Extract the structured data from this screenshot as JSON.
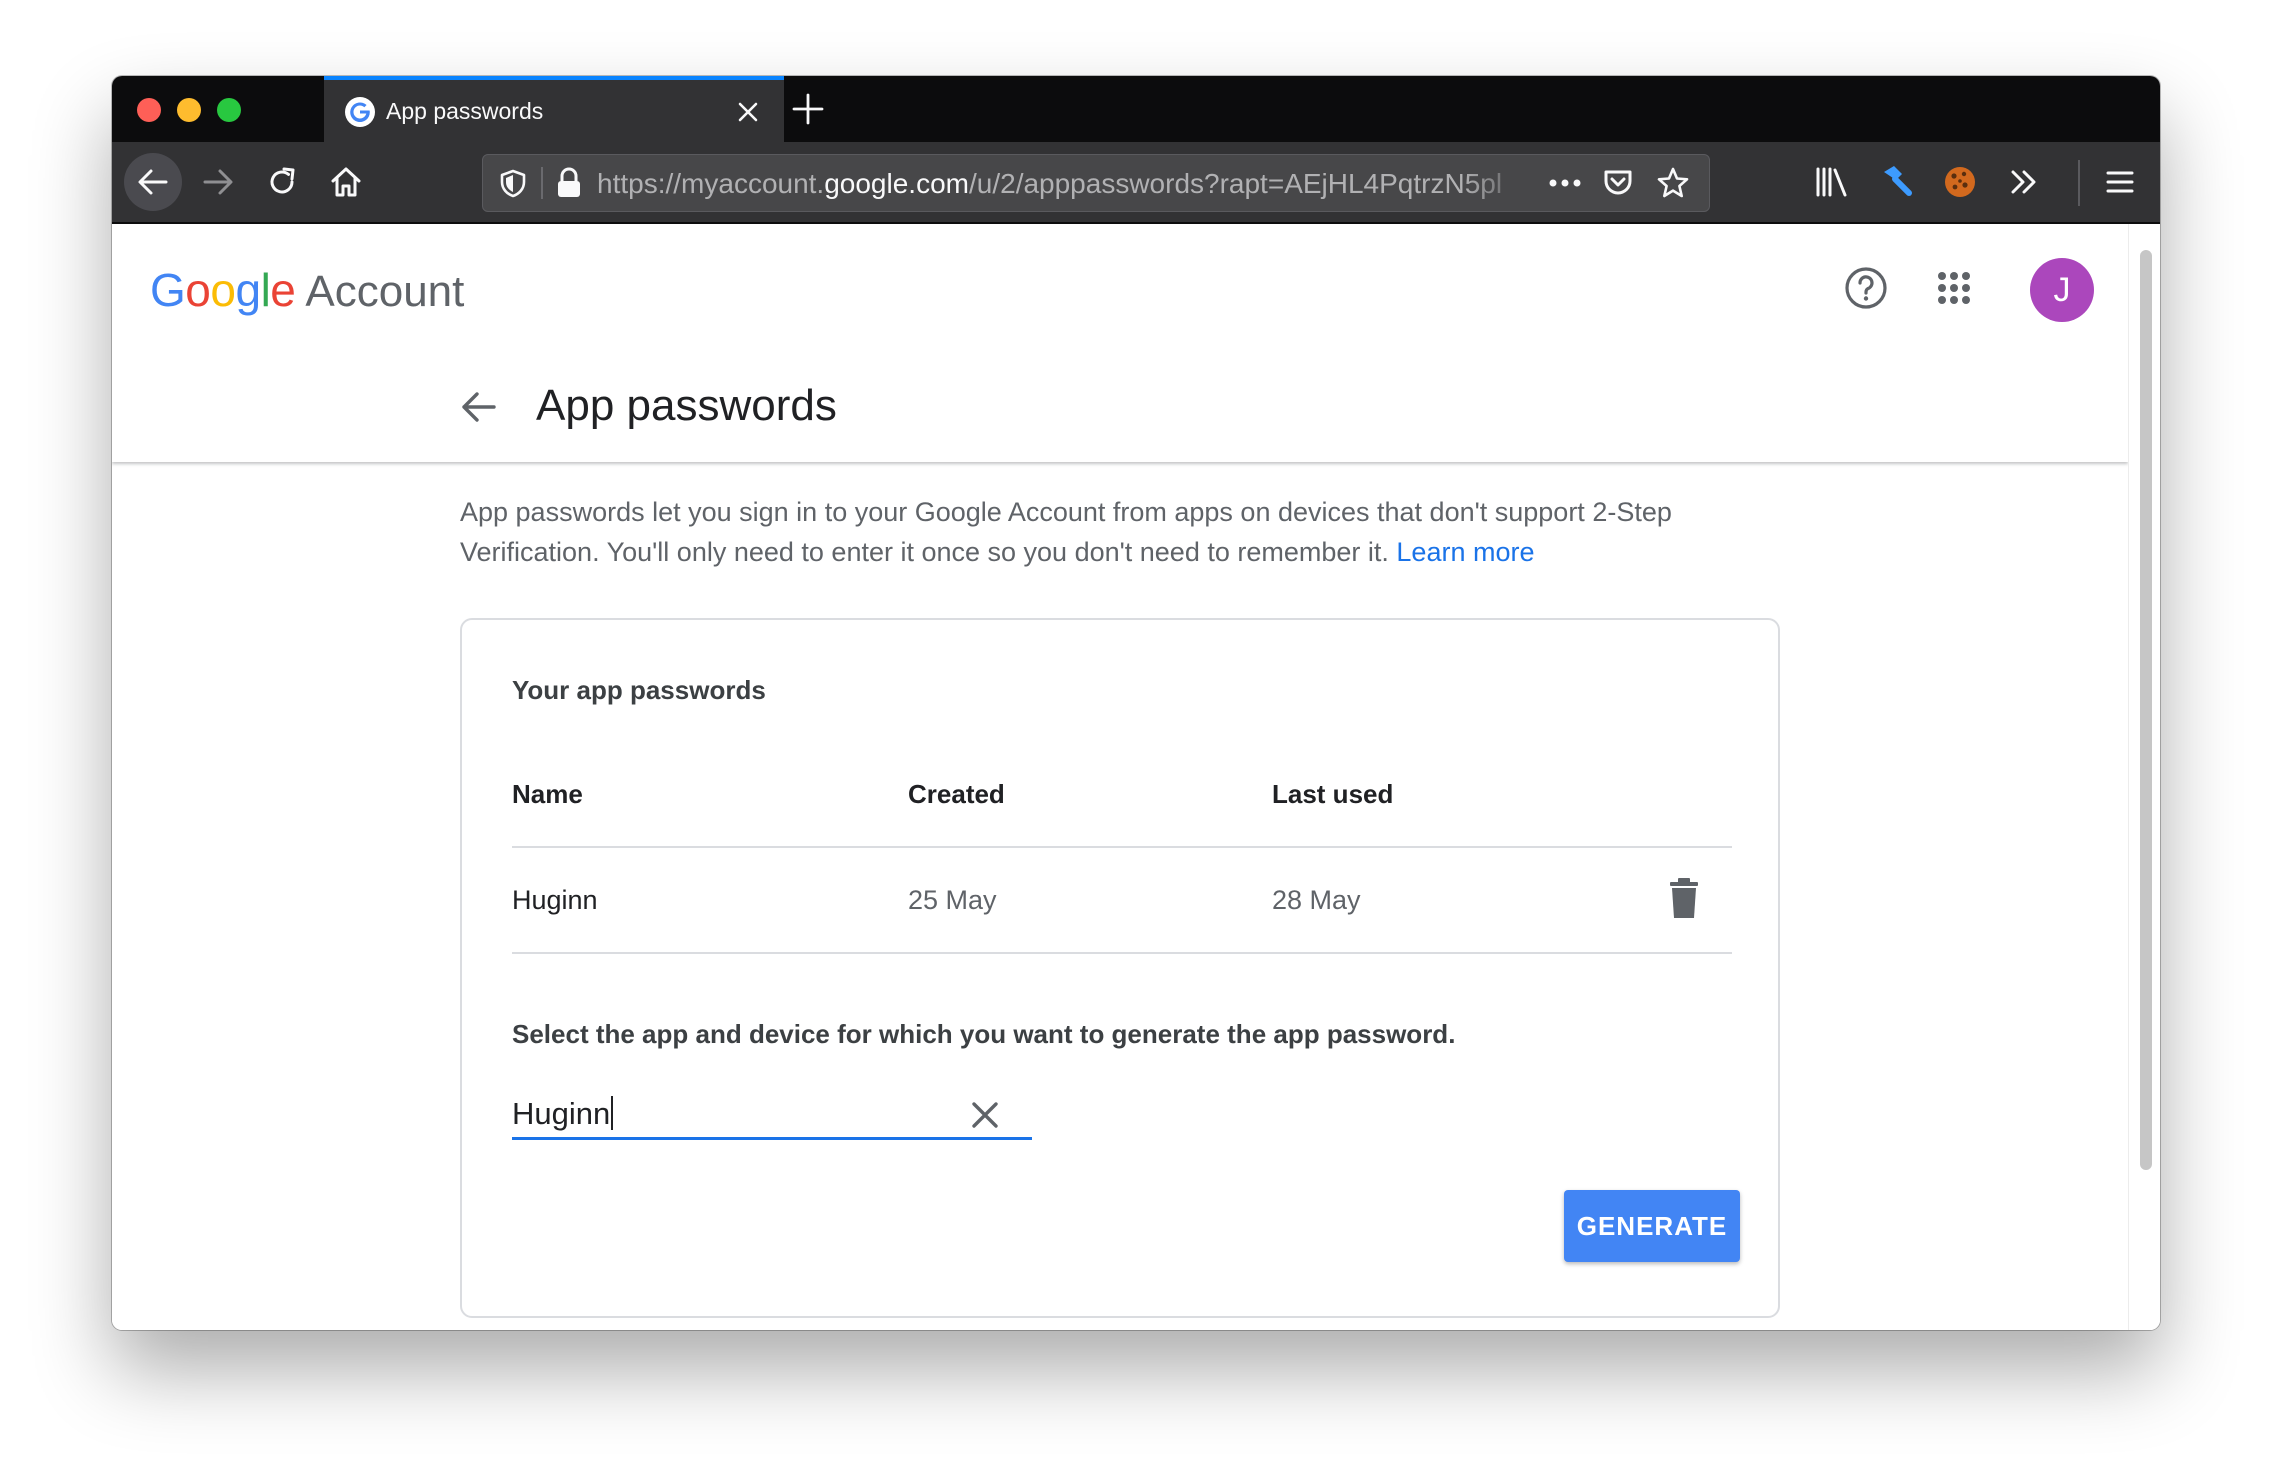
{
  "browser": {
    "tab_title": "App passwords",
    "url_prefix": "https://myaccount.",
    "url_domain": "google.com",
    "url_path": "/u/2/apppasswords?rapt=AEjHL4PqtrzN5pl"
  },
  "header": {
    "logo_letters": [
      "G",
      "o",
      "o",
      "g",
      "l",
      "e"
    ],
    "logo_colors": [
      "#4285f4",
      "#ea4335",
      "#fbbc05",
      "#4285f4",
      "#34a853",
      "#ea4335"
    ],
    "logo_suffix": "Account",
    "avatar_initial": "J",
    "avatar_color": "#ab47bc"
  },
  "page": {
    "title": "App passwords",
    "intro": "App passwords let you sign in to your Google Account from apps on devices that don't support 2-Step Verification. You'll only need to enter it once so you don't need to remember it.",
    "learn_more": "Learn more"
  },
  "card": {
    "title": "Your app passwords",
    "columns": [
      "Name",
      "Created",
      "Last used"
    ],
    "rows": [
      {
        "name": "Huginn",
        "created": "25 May",
        "last_used": "28 May"
      }
    ],
    "select_label": "Select the app and device for which you want to generate the app password.",
    "input_value": "Huginn",
    "generate_label": "GENERATE"
  },
  "colors": {
    "accent": "#1a73e8",
    "button": "#4285f4"
  }
}
